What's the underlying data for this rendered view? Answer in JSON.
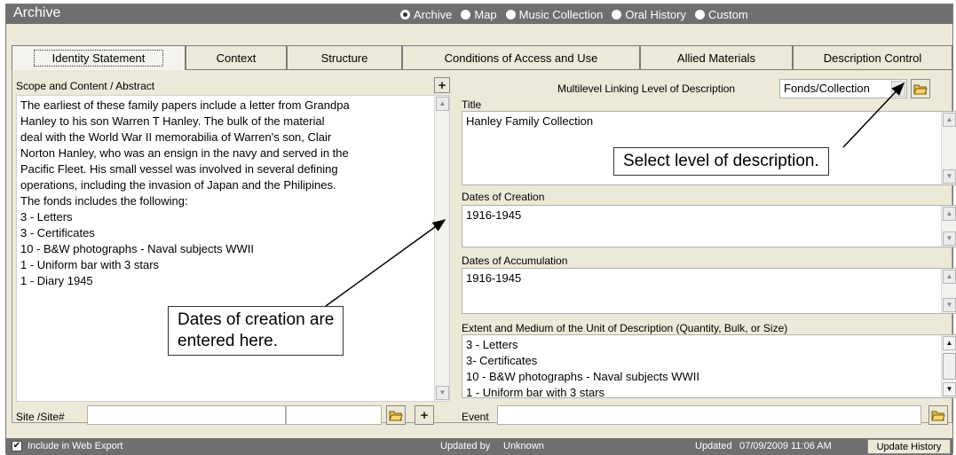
{
  "app": {
    "title": "Archive"
  },
  "view_modes": {
    "options": [
      "Archive",
      "Map",
      "Music Collection",
      "Oral History",
      "Custom"
    ],
    "selected": "Archive"
  },
  "tabs": [
    {
      "label": "Identity Statement",
      "active": true
    },
    {
      "label": "Context",
      "active": false
    },
    {
      "label": "Structure",
      "active": false
    },
    {
      "label": "Conditions of Access and Use",
      "active": false
    },
    {
      "label": "Allied Materials",
      "active": false
    },
    {
      "label": "Description Control",
      "active": false
    }
  ],
  "scope": {
    "label": "Scope and Content / Abstract",
    "lines": [
      "The earliest of these family papers include a letter from Grandpa",
      "Hanley to his son Warren T Hanley.  The bulk of the material",
      "deal with the World War II memorabilia of Warren's son, Clair",
      "Norton Hanley, who was an ensign in the navy and served in the",
      "Pacific Fleet. His small vessel was involved in several defining",
      "operations, including the invasion of Japan and the Philipines.",
      "The fonds includes the following:",
      "3 - Letters",
      "3 - Certificates",
      "10 - B&W photographs - Naval subjects WWII",
      "1 - Uniform bar with 3 stars",
      "1 - Diary 1945"
    ]
  },
  "site": {
    "label": "Site /Site#",
    "value": "",
    "value2": ""
  },
  "level": {
    "label": "Multilevel Linking Level of Description",
    "value": "Fonds/Collection"
  },
  "title_field": {
    "label": "Title",
    "value": "Hanley Family Collection"
  },
  "dates_creation": {
    "label": "Dates of Creation",
    "value": "1916-1945"
  },
  "dates_accumulation": {
    "label": "Dates of Accumulation",
    "value": "1916-1945"
  },
  "extent": {
    "label": "Extent and Medium of the Unit of Description (Quantity, Bulk, or Size)",
    "lines": [
      "3 - Letters",
      "3- Certificates",
      "10 - B&W photographs - Naval subjects WWII",
      "1 - Uniform bar with 3 stars"
    ]
  },
  "event": {
    "label": "Event",
    "value": ""
  },
  "callouts": {
    "level": "Select level of description.",
    "dates": [
      "Dates of creation are",
      "entered here."
    ]
  },
  "status": {
    "web_export_label": "Include in Web Export",
    "web_export_checked": true,
    "updated_by_label": "Updated by",
    "updated_by_value": "Unknown",
    "updated_label": "Updated",
    "updated_value": "07/09/2009 11:06 AM",
    "update_history_label": "Update History"
  },
  "colors": {
    "titlebar": "#6f6f6f",
    "panel": "#ece9d8",
    "statusbar": "#6f6f6f"
  }
}
